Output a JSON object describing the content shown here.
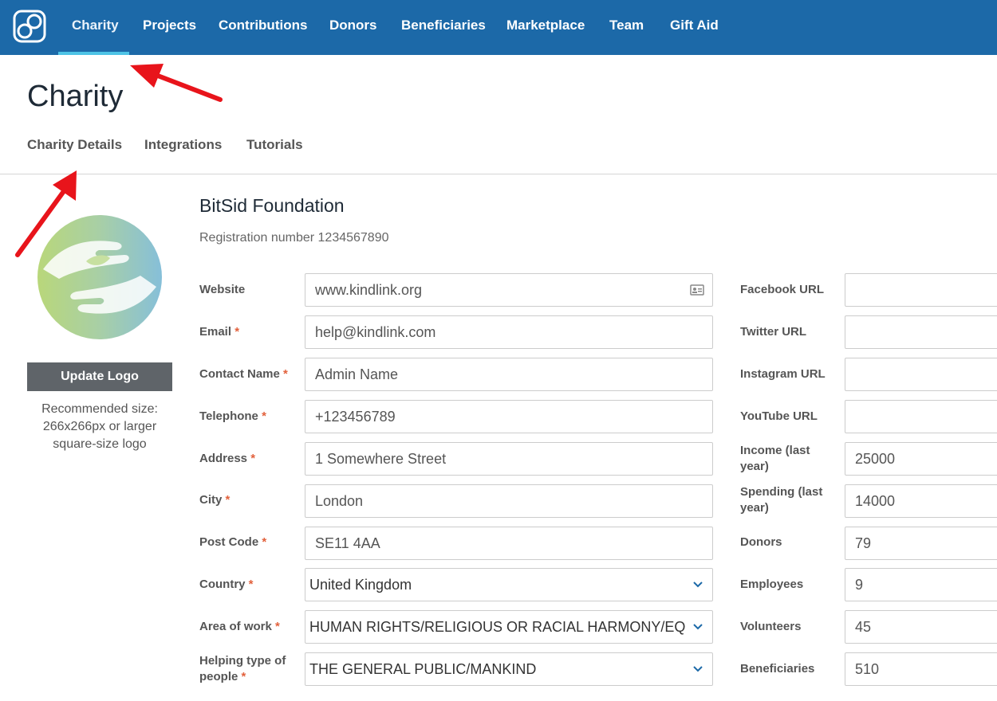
{
  "nav": {
    "items": [
      "Charity",
      "Projects",
      "Contributions",
      "Donors",
      "Beneficiaries",
      "Marketplace",
      "Team",
      "Gift Aid"
    ],
    "active": "Charity"
  },
  "page": {
    "title": "Charity",
    "tabs": [
      "Charity Details",
      "Integrations",
      "Tutorials"
    ]
  },
  "logo_panel": {
    "update_label": "Update Logo",
    "recommend_lines": [
      "Recommended size:",
      "266x266px or larger",
      "square-size logo"
    ]
  },
  "org": {
    "name": "BitSid Foundation",
    "registration": "Registration number 1234567890"
  },
  "left_fields": [
    {
      "label": "Website",
      "required": false,
      "value": "www.kindlink.org",
      "type": "text"
    },
    {
      "label": "Email",
      "required": true,
      "value": "help@kindlink.com",
      "type": "text"
    },
    {
      "label": "Contact Name",
      "required": true,
      "value": "Admin Name",
      "type": "text"
    },
    {
      "label": "Telephone",
      "required": true,
      "value": "+123456789",
      "type": "text"
    },
    {
      "label": "Address",
      "required": true,
      "value": "1 Somewhere Street",
      "type": "text"
    },
    {
      "label": "City",
      "required": true,
      "value": "London",
      "type": "text"
    },
    {
      "label": "Post Code",
      "required": true,
      "value": "SE11 4AA",
      "type": "text"
    },
    {
      "label": "Country",
      "required": true,
      "value": "United Kingdom",
      "type": "select"
    },
    {
      "label": "Area of work",
      "required": true,
      "value": "HUMAN RIGHTS/RELIGIOUS OR RACIAL HARMONY/EQUALITY",
      "type": "select"
    },
    {
      "label_lines": [
        "Helping type of",
        "people"
      ],
      "required": true,
      "value": "THE GENERAL PUBLIC/MANKIND",
      "type": "select"
    }
  ],
  "right_fields": [
    {
      "label": "Facebook URL",
      "value": ""
    },
    {
      "label": "Twitter URL",
      "value": ""
    },
    {
      "label": "Instagram URL",
      "value": ""
    },
    {
      "label": "YouTube URL",
      "value": ""
    },
    {
      "label_lines": [
        "Income (last",
        "year)"
      ],
      "value": "25000"
    },
    {
      "label_lines": [
        "Spending (last",
        "year)"
      ],
      "value": "14000"
    },
    {
      "label": "Donors",
      "value": "79"
    },
    {
      "label": "Employees",
      "value": "9"
    },
    {
      "label": "Volunteers",
      "value": "45"
    },
    {
      "label": "Beneficiaries",
      "value": "510"
    }
  ],
  "colors": {
    "nav_bg": "#1c69a8",
    "nav_underline": "#4ec3e6",
    "required": "#e2613c",
    "annotation_arrow": "#e8141b"
  },
  "icons": {
    "brand": "linked-loops-logo-icon",
    "website_field": "address-card-icon",
    "select": "chevron-down-icon"
  }
}
